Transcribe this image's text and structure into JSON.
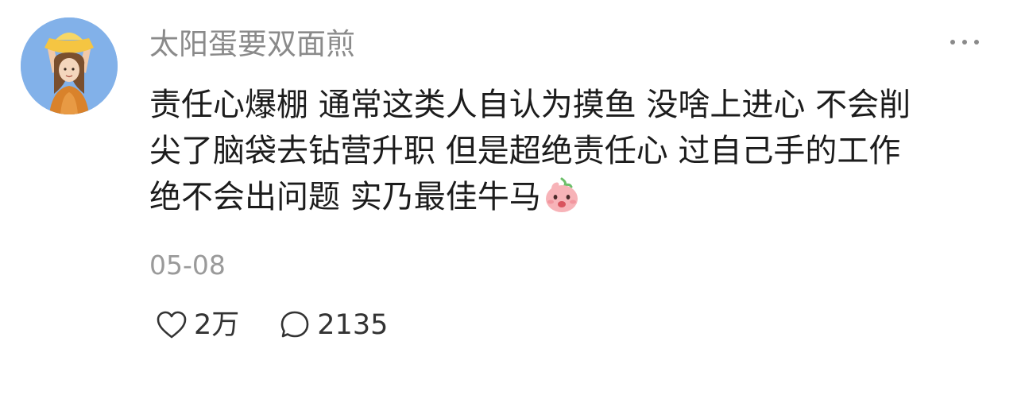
{
  "comment": {
    "author": "太阳蛋要双面煎",
    "avatar_icon": "avatar-image",
    "more_icon": "more-dots-icon",
    "content_lines": [
      "责任心爆棚 通常这类人自认为摸鱼 没啥上进心 不会削",
      "尖了脑袋去钻营升职 但是超绝责任心 过自己手的工作",
      "绝不会出问题 实乃最佳牛马"
    ],
    "emoji_icon": "pink-face-emoji-icon",
    "date": "05-08",
    "likes": {
      "icon": "heart-outline-icon",
      "count": "2万"
    },
    "replies": {
      "icon": "speech-bubble-icon",
      "count": "2135"
    },
    "colors": {
      "author": "#8a8a8a",
      "text": "#1c1c1c",
      "date": "#9a9a9a",
      "avatar_bg": "#82b1e9"
    }
  }
}
